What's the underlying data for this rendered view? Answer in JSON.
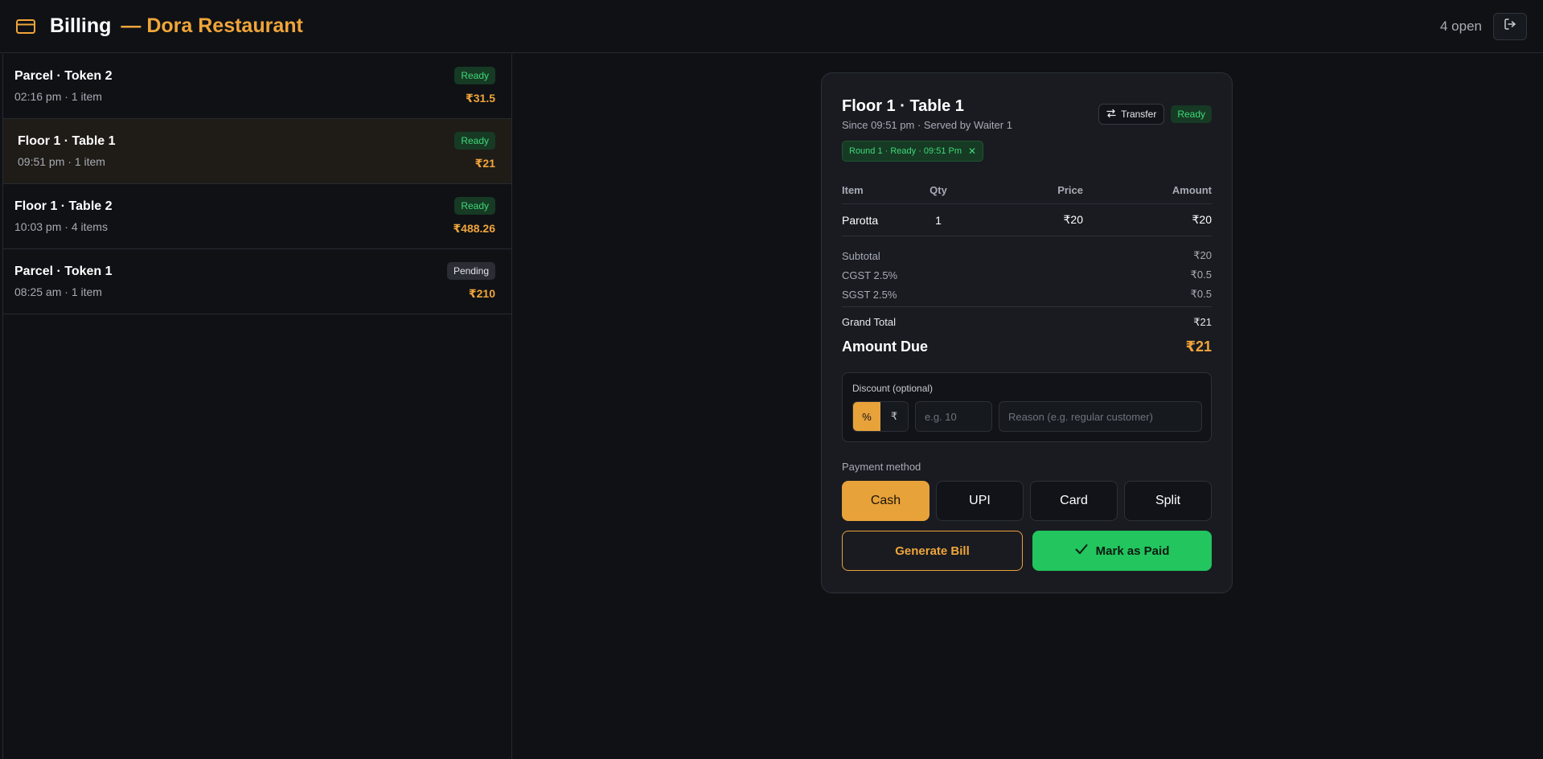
{
  "header": {
    "title": "Billing",
    "restaurant": "— Dora Restaurant",
    "open_count": "4 open",
    "icons": {
      "brand": "card-icon",
      "logout": "logout-icon"
    },
    "accent_color": "#f0a53a"
  },
  "orders": [
    {
      "name": "Parcel · Token 2",
      "meta": "02:16 pm · 1 item",
      "status": "Ready",
      "amount": "₹31.5"
    },
    {
      "name": "Floor 1 · Table 1",
      "meta": "09:51 pm · 1 item",
      "status": "Ready",
      "amount": "₹21",
      "selected": true
    },
    {
      "name": "Floor 1 · Table 2",
      "meta": "10:03 pm · 4 items",
      "status": "Ready",
      "amount": "₹488.26"
    },
    {
      "name": "Parcel · Token 1",
      "meta": "08:25 am · 1 item",
      "status": "Pending",
      "amount": "₹210"
    }
  ],
  "bill": {
    "title": "Floor 1 · Table 1",
    "subtitle": "Since 09:51 pm · Served by Waiter 1",
    "transfer_label": "Transfer",
    "status": "Ready",
    "round_chip": "Round 1 · Ready · 09:51 Pm",
    "columns": {
      "item": "Item",
      "qty": "Qty",
      "price": "Price",
      "amount": "Amount"
    },
    "items": [
      {
        "item": "Parotta",
        "qty": "1",
        "price": "₹20",
        "amount": "₹20"
      }
    ],
    "totals": {
      "subtotal_label": "Subtotal",
      "subtotal": "₹20",
      "cgst_label": "CGST 2.5%",
      "cgst": "₹0.5",
      "sgst_label": "SGST 2.5%",
      "sgst": "₹0.5",
      "grand_label": "Grand Total",
      "grand": "₹21"
    },
    "due_label": "Amount Due",
    "due": "₹21",
    "discount": {
      "label": "Discount (optional)",
      "percent_symbol": "%",
      "rupee_symbol": "₹",
      "selected_mode": "%",
      "value_placeholder": "e.g. 10",
      "reason_placeholder": "Reason (e.g. regular customer)"
    },
    "payment": {
      "label": "Payment method",
      "methods": [
        "Cash",
        "UPI",
        "Card",
        "Split"
      ],
      "selected": "Cash"
    },
    "generate_label": "Generate Bill",
    "paid_label": "Mark as Paid"
  }
}
